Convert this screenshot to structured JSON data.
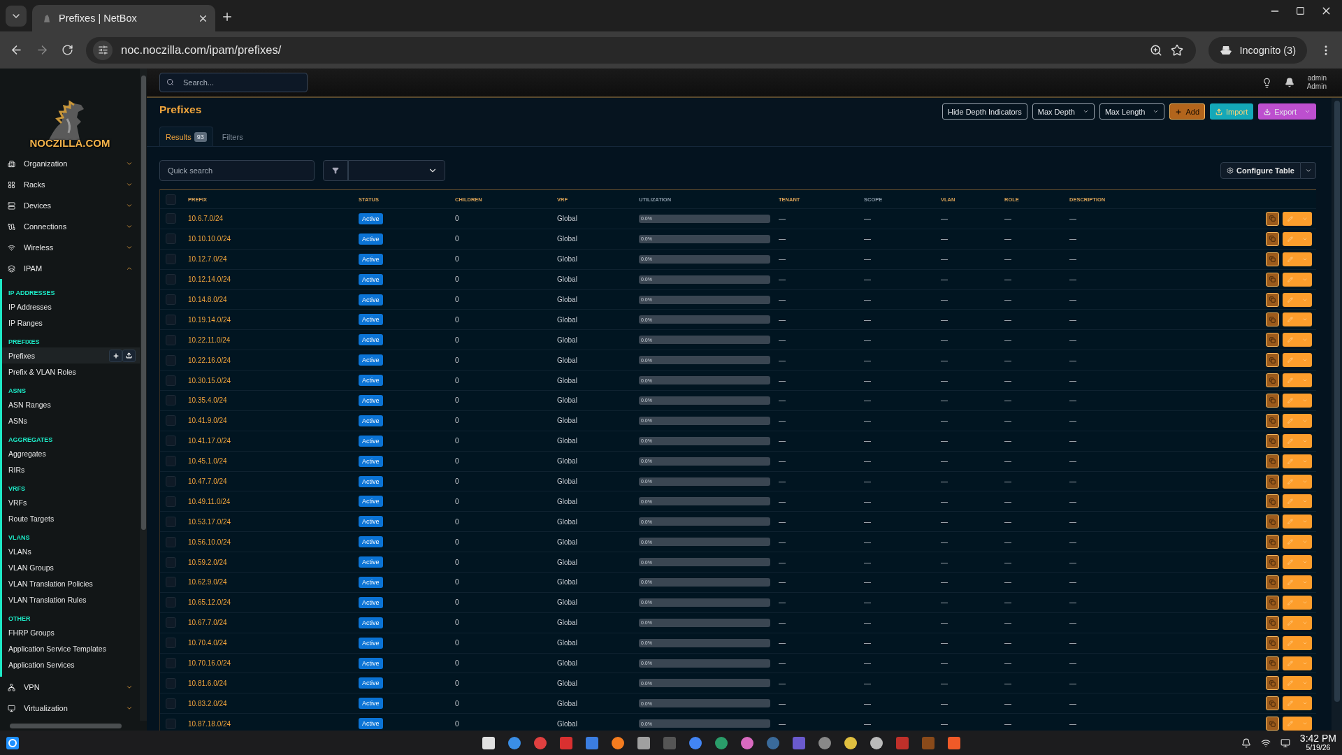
{
  "browser": {
    "tab_title": "Prefixes | NetBox",
    "url": "noc.noczilla.com/ipam/prefixes/",
    "profile": "Incognito (3)"
  },
  "sidebar": {
    "logo_text": "NOCZILLA.COM",
    "menu": [
      {
        "label": "Organization",
        "expanded": false
      },
      {
        "label": "Racks",
        "expanded": false
      },
      {
        "label": "Devices",
        "expanded": false
      },
      {
        "label": "Connections",
        "expanded": false
      },
      {
        "label": "Wireless",
        "expanded": false
      },
      {
        "label": "IPAM",
        "expanded": true,
        "groups": [
          {
            "heading": "IP ADDRESSES",
            "items": [
              {
                "label": "IP Addresses",
                "selected": false
              },
              {
                "label": "IP Ranges",
                "selected": false
              }
            ]
          },
          {
            "heading": "PREFIXES",
            "items": [
              {
                "label": "Prefixes",
                "selected": true
              },
              {
                "label": "Prefix & VLAN Roles",
                "selected": false
              }
            ]
          },
          {
            "heading": "ASNS",
            "items": [
              {
                "label": "ASN Ranges",
                "selected": false
              },
              {
                "label": "ASNs",
                "selected": false
              }
            ]
          },
          {
            "heading": "AGGREGATES",
            "items": [
              {
                "label": "Aggregates",
                "selected": false
              },
              {
                "label": "RIRs",
                "selected": false
              }
            ]
          },
          {
            "heading": "VRFS",
            "items": [
              {
                "label": "VRFs",
                "selected": false
              },
              {
                "label": "Route Targets",
                "selected": false
              }
            ]
          },
          {
            "heading": "VLANS",
            "items": [
              {
                "label": "VLANs",
                "selected": false
              },
              {
                "label": "VLAN Groups",
                "selected": false
              },
              {
                "label": "VLAN Translation Policies",
                "selected": false
              },
              {
                "label": "VLAN Translation Rules",
                "selected": false
              }
            ]
          },
          {
            "heading": "OTHER",
            "items": [
              {
                "label": "FHRP Groups",
                "selected": false
              },
              {
                "label": "Application Service Templates",
                "selected": false
              },
              {
                "label": "Application Services",
                "selected": false
              }
            ]
          }
        ]
      },
      {
        "label": "VPN",
        "expanded": false
      },
      {
        "label": "Virtualization",
        "expanded": false
      }
    ]
  },
  "topbar": {
    "search_placeholder": "Search...",
    "user_name": "admin",
    "user_role": "Admin"
  },
  "page": {
    "title": "Prefixes",
    "actions": [
      {
        "label": "Hide Depth Indicators",
        "kind": "outline"
      },
      {
        "label": "Max Depth",
        "kind": "dropdown"
      },
      {
        "label": "Max Length",
        "kind": "dropdown"
      },
      {
        "label": "Add",
        "kind": "add"
      },
      {
        "label": "Import",
        "kind": "import"
      },
      {
        "label": "Export",
        "kind": "export"
      }
    ],
    "tabs": [
      {
        "label": "Results",
        "badge": "93",
        "selected": true
      },
      {
        "label": "Filters",
        "selected": false
      }
    ]
  },
  "toolbar": {
    "quick_search_placeholder": "Quick search",
    "configure_label": "Configure Table"
  },
  "table": {
    "select_all_checked": false,
    "columns": [
      {
        "label": "PREFIX",
        "sortable": true
      },
      {
        "label": "STATUS",
        "sortable": true
      },
      {
        "label": "CHILDREN",
        "sortable": true
      },
      {
        "label": "VRF",
        "sortable": true
      },
      {
        "label": "UTILIZATION",
        "sortable": false
      },
      {
        "label": "TENANT",
        "sortable": true
      },
      {
        "label": "SCOPE",
        "sortable": false
      },
      {
        "label": "VLAN",
        "sortable": true
      },
      {
        "label": "ROLE",
        "sortable": true
      },
      {
        "label": "DESCRIPTION",
        "sortable": true
      }
    ],
    "rows": [
      {
        "checked": false,
        "prefix": "10.6.7.0/24",
        "status": "Active",
        "children": "0",
        "vrf": "Global",
        "utilization": {
          "reading": "0.0%",
          "level": 0
        },
        "tenant": "—",
        "scope": "—",
        "vlan": "—",
        "role": "—",
        "description": "—"
      },
      {
        "checked": false,
        "prefix": "10.10.10.0/24",
        "status": "Active",
        "children": "0",
        "vrf": "Global",
        "utilization": {
          "reading": "0.0%",
          "level": 0
        },
        "tenant": "—",
        "scope": "—",
        "vlan": "—",
        "role": "—",
        "description": "—"
      },
      {
        "checked": false,
        "prefix": "10.12.7.0/24",
        "status": "Active",
        "children": "0",
        "vrf": "Global",
        "utilization": {
          "reading": "0.0%",
          "level": 0
        },
        "tenant": "—",
        "scope": "—",
        "vlan": "—",
        "role": "—",
        "description": "—"
      },
      {
        "checked": false,
        "prefix": "10.12.14.0/24",
        "status": "Active",
        "children": "0",
        "vrf": "Global",
        "utilization": {
          "reading": "0.0%",
          "level": 0
        },
        "tenant": "—",
        "scope": "—",
        "vlan": "—",
        "role": "—",
        "description": "—"
      },
      {
        "checked": false,
        "prefix": "10.14.8.0/24",
        "status": "Active",
        "children": "0",
        "vrf": "Global",
        "utilization": {
          "reading": "0.0%",
          "level": 0
        },
        "tenant": "—",
        "scope": "—",
        "vlan": "—",
        "role": "—",
        "description": "—"
      },
      {
        "checked": false,
        "prefix": "10.19.14.0/24",
        "status": "Active",
        "children": "0",
        "vrf": "Global",
        "utilization": {
          "reading": "0.0%",
          "level": 0
        },
        "tenant": "—",
        "scope": "—",
        "vlan": "—",
        "role": "—",
        "description": "—"
      },
      {
        "checked": false,
        "prefix": "10.22.11.0/24",
        "status": "Active",
        "children": "0",
        "vrf": "Global",
        "utilization": {
          "reading": "0.0%",
          "level": 0
        },
        "tenant": "—",
        "scope": "—",
        "vlan": "—",
        "role": "—",
        "description": "—"
      },
      {
        "checked": false,
        "prefix": "10.22.16.0/24",
        "status": "Active",
        "children": "0",
        "vrf": "Global",
        "utilization": {
          "reading": "0.0%",
          "level": 0
        },
        "tenant": "—",
        "scope": "—",
        "vlan": "—",
        "role": "—",
        "description": "—"
      },
      {
        "checked": false,
        "prefix": "10.30.15.0/24",
        "status": "Active",
        "children": "0",
        "vrf": "Global",
        "utilization": {
          "reading": "0.0%",
          "level": 0
        },
        "tenant": "—",
        "scope": "—",
        "vlan": "—",
        "role": "—",
        "description": "—"
      },
      {
        "checked": false,
        "prefix": "10.35.4.0/24",
        "status": "Active",
        "children": "0",
        "vrf": "Global",
        "utilization": {
          "reading": "0.0%",
          "level": 0
        },
        "tenant": "—",
        "scope": "—",
        "vlan": "—",
        "role": "—",
        "description": "—"
      },
      {
        "checked": false,
        "prefix": "10.41.9.0/24",
        "status": "Active",
        "children": "0",
        "vrf": "Global",
        "utilization": {
          "reading": "0.0%",
          "level": 0
        },
        "tenant": "—",
        "scope": "—",
        "vlan": "—",
        "role": "—",
        "description": "—"
      },
      {
        "checked": false,
        "prefix": "10.41.17.0/24",
        "status": "Active",
        "children": "0",
        "vrf": "Global",
        "utilization": {
          "reading": "0.0%",
          "level": 0
        },
        "tenant": "—",
        "scope": "—",
        "vlan": "—",
        "role": "—",
        "description": "—"
      },
      {
        "checked": false,
        "prefix": "10.45.1.0/24",
        "status": "Active",
        "children": "0",
        "vrf": "Global",
        "utilization": {
          "reading": "0.0%",
          "level": 0
        },
        "tenant": "—",
        "scope": "—",
        "vlan": "—",
        "role": "—",
        "description": "—"
      },
      {
        "checked": false,
        "prefix": "10.47.7.0/24",
        "status": "Active",
        "children": "0",
        "vrf": "Global",
        "utilization": {
          "reading": "0.0%",
          "level": 0
        },
        "tenant": "—",
        "scope": "—",
        "vlan": "—",
        "role": "—",
        "description": "—"
      },
      {
        "checked": false,
        "prefix": "10.49.11.0/24",
        "status": "Active",
        "children": "0",
        "vrf": "Global",
        "utilization": {
          "reading": "0.0%",
          "level": 0
        },
        "tenant": "—",
        "scope": "—",
        "vlan": "—",
        "role": "—",
        "description": "—"
      },
      {
        "checked": false,
        "prefix": "10.53.17.0/24",
        "status": "Active",
        "children": "0",
        "vrf": "Global",
        "utilization": {
          "reading": "0.0%",
          "level": 0
        },
        "tenant": "—",
        "scope": "—",
        "vlan": "—",
        "role": "—",
        "description": "—"
      },
      {
        "checked": false,
        "prefix": "10.56.10.0/24",
        "status": "Active",
        "children": "0",
        "vrf": "Global",
        "utilization": {
          "reading": "0.0%",
          "level": 0
        },
        "tenant": "—",
        "scope": "—",
        "vlan": "—",
        "role": "—",
        "description": "—"
      },
      {
        "checked": false,
        "prefix": "10.59.2.0/24",
        "status": "Active",
        "children": "0",
        "vrf": "Global",
        "utilization": {
          "reading": "0.0%",
          "level": 0
        },
        "tenant": "—",
        "scope": "—",
        "vlan": "—",
        "role": "—",
        "description": "—"
      },
      {
        "checked": false,
        "prefix": "10.62.9.0/24",
        "status": "Active",
        "children": "0",
        "vrf": "Global",
        "utilization": {
          "reading": "0.0%",
          "level": 0
        },
        "tenant": "—",
        "scope": "—",
        "vlan": "—",
        "role": "—",
        "description": "—"
      },
      {
        "checked": false,
        "prefix": "10.65.12.0/24",
        "status": "Active",
        "children": "0",
        "vrf": "Global",
        "utilization": {
          "reading": "0.0%",
          "level": 0
        },
        "tenant": "—",
        "scope": "—",
        "vlan": "—",
        "role": "—",
        "description": "—"
      },
      {
        "checked": false,
        "prefix": "10.67.7.0/24",
        "status": "Active",
        "children": "0",
        "vrf": "Global",
        "utilization": {
          "reading": "0.0%",
          "level": 0
        },
        "tenant": "—",
        "scope": "—",
        "vlan": "—",
        "role": "—",
        "description": "—"
      },
      {
        "checked": false,
        "prefix": "10.70.4.0/24",
        "status": "Active",
        "children": "0",
        "vrf": "Global",
        "utilization": {
          "reading": "0.0%",
          "level": 0
        },
        "tenant": "—",
        "scope": "—",
        "vlan": "—",
        "role": "—",
        "description": "—"
      },
      {
        "checked": false,
        "prefix": "10.70.16.0/24",
        "status": "Active",
        "children": "0",
        "vrf": "Global",
        "utilization": {
          "reading": "0.0%",
          "level": 0
        },
        "tenant": "—",
        "scope": "—",
        "vlan": "—",
        "role": "—",
        "description": "—"
      },
      {
        "checked": false,
        "prefix": "10.81.6.0/24",
        "status": "Active",
        "children": "0",
        "vrf": "Global",
        "utilization": {
          "reading": "0.0%",
          "level": 0
        },
        "tenant": "—",
        "scope": "—",
        "vlan": "—",
        "role": "—",
        "description": "—"
      },
      {
        "checked": false,
        "prefix": "10.83.2.0/24",
        "status": "Active",
        "children": "0",
        "vrf": "Global",
        "utilization": {
          "reading": "0.0%",
          "level": 0
        },
        "tenant": "—",
        "scope": "—",
        "vlan": "—",
        "role": "—",
        "description": "—"
      },
      {
        "checked": false,
        "prefix": "10.87.18.0/24",
        "status": "Active",
        "children": "0",
        "vrf": "Global",
        "utilization": {
          "reading": "0.0%",
          "level": 0
        },
        "tenant": "—",
        "scope": "—",
        "vlan": "—",
        "role": "—",
        "description": "—"
      }
    ]
  },
  "taskbar": {
    "time": "3:42 PM",
    "date": "5/19/26"
  }
}
